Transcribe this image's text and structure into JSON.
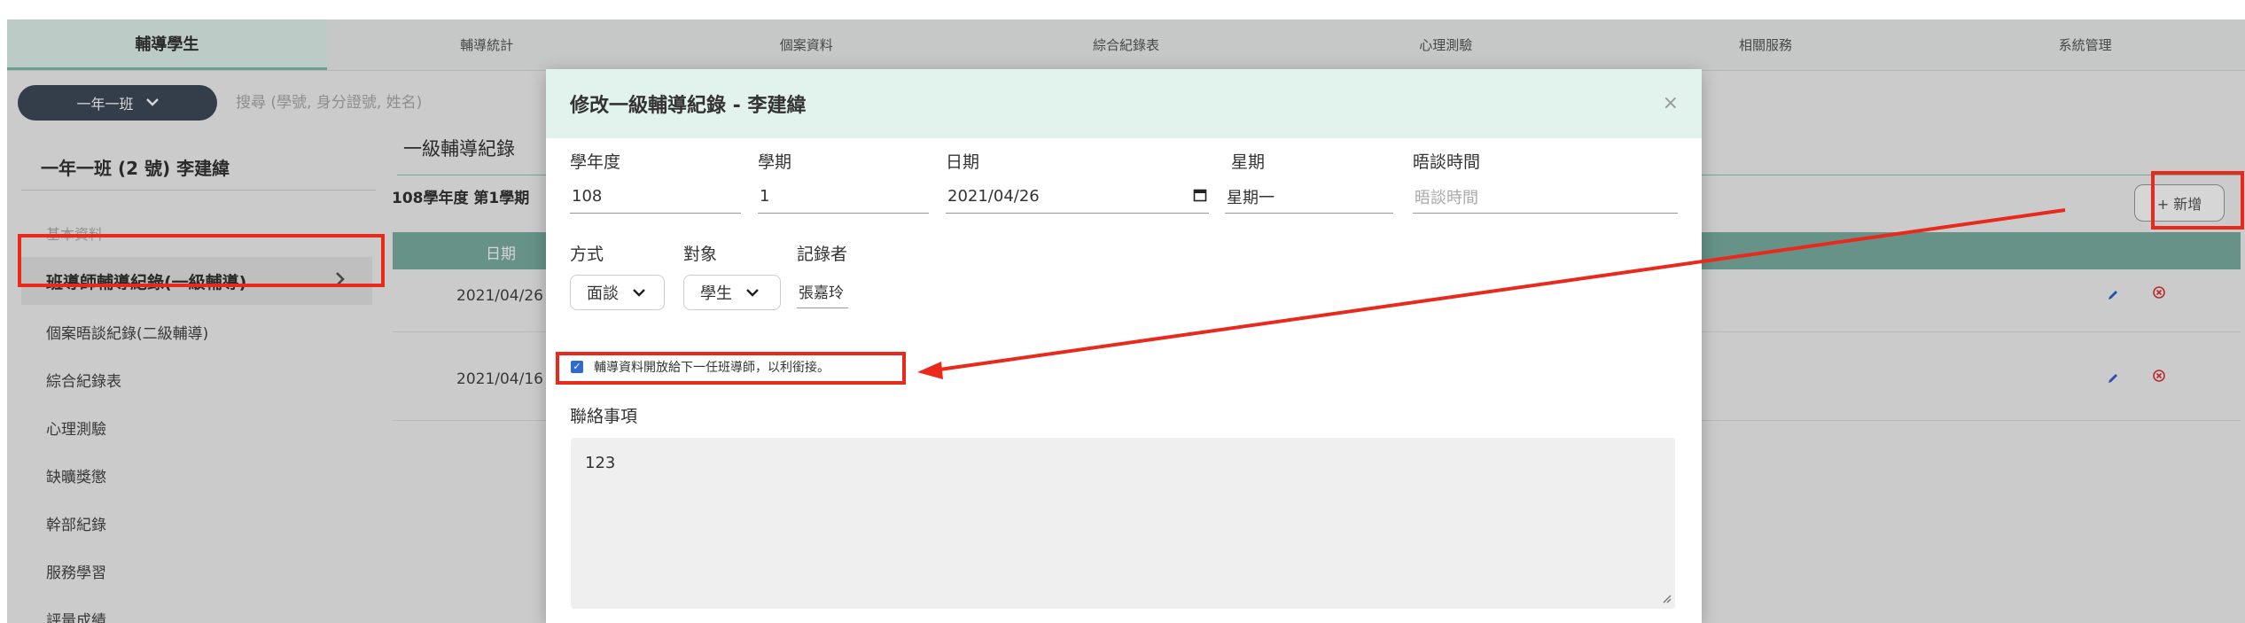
{
  "nav": {
    "tabs": [
      {
        "label": "輔導學生",
        "active": true
      },
      {
        "label": "輔導統計"
      },
      {
        "label": "個案資料"
      },
      {
        "label": "綜合紀錄表"
      },
      {
        "label": "心理測驗"
      },
      {
        "label": "相關服務"
      },
      {
        "label": "系統管理"
      }
    ]
  },
  "toolbar": {
    "class_value": "一年一班",
    "search_placeholder": "搜尋 (學號, 身分證號, 姓名)"
  },
  "sidebar": {
    "student_title": "一年一班 (2 號) 李建緯",
    "section_label": "基本資料",
    "active_item": "班導師輔導紀錄(一級輔導)",
    "items": [
      "個案晤談紀錄(二級輔導)",
      "綜合紀錄表",
      "心理測驗",
      "缺曠獎懲",
      "幹部紀錄",
      "服務學習",
      "評量成績"
    ]
  },
  "main": {
    "title": "一級輔導紀錄",
    "semester": "108學年度 第1學期",
    "add_label": "+ 新增",
    "table_header_date": "日期",
    "rows": [
      {
        "date": "2021/04/26"
      },
      {
        "date": "2021/04/16"
      }
    ]
  },
  "modal": {
    "title": "修改一級輔導紀錄 - 李建緯",
    "close_glyph": "×",
    "labels": {
      "school_year": "學年度",
      "semester": "學期",
      "date": "日期",
      "weekday": "星期",
      "talk_time": "晤談時間",
      "method": "方式",
      "target": "對象",
      "recorder": "記錄者",
      "contact": "聯絡事項"
    },
    "values": {
      "school_year": "108",
      "semester": "1",
      "date": "2021/04/26",
      "weekday": "星期一",
      "talk_time_placeholder": "晤談時間",
      "method": "面談",
      "target": "學生",
      "recorder": "張嘉玲",
      "contact": "123"
    },
    "checkbox_label": "輔導資料開放給下一任班導師，以利銜接。",
    "checkbox_checked": true
  },
  "colors": {
    "annotation": "#e8291c",
    "table_header": "#7aaea2",
    "modal_header": "#e2f2ec",
    "class_select": "#3f4a59"
  },
  "icons": [
    "chevron-down-icon",
    "chevron-right-icon",
    "close-icon",
    "calendar-icon",
    "edit-icon",
    "delete-icon",
    "check-icon",
    "resize-handle-icon"
  ]
}
